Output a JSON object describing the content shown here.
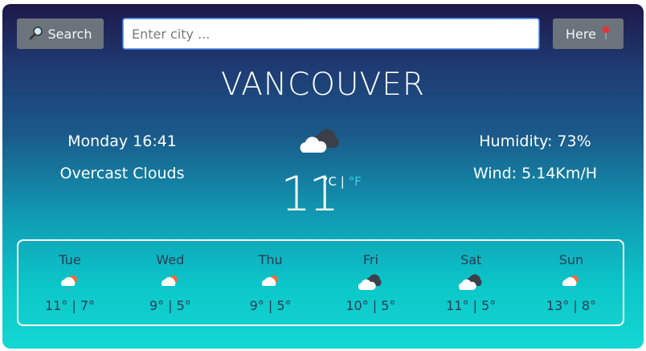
{
  "search": {
    "button_label": "Search",
    "placeholder": "Enter city ...",
    "value": ""
  },
  "here": {
    "button_label": "Here"
  },
  "city": "VANCOUVER",
  "current": {
    "day_time": "Monday 16:41",
    "condition": "Overcast Clouds",
    "temperature": "11",
    "unit_c": "°C",
    "unit_sep": "|",
    "unit_f": "°F",
    "humidity": "Humidity: 73%",
    "wind": "Wind: 5.14Km/H",
    "icon": "overcast-clouds-icon"
  },
  "forecast": [
    {
      "day": "Tue",
      "temps": "11° | 7°",
      "icon": "rain-sun-cloud-icon"
    },
    {
      "day": "Wed",
      "temps": "9° | 5°",
      "icon": "rain-sun-cloud-icon"
    },
    {
      "day": "Thu",
      "temps": "9° | 5°",
      "icon": "rain-sun-cloud-icon"
    },
    {
      "day": "Fri",
      "temps": "10° | 5°",
      "icon": "overcast-clouds-icon"
    },
    {
      "day": "Sat",
      "temps": "11° | 5°",
      "icon": "overcast-clouds-icon"
    },
    {
      "day": "Sun",
      "temps": "13° | 8°",
      "icon": "rain-sun-cloud-icon"
    }
  ],
  "colors": {
    "accent_f": "#3fd1e6",
    "button": "#6b747c"
  }
}
